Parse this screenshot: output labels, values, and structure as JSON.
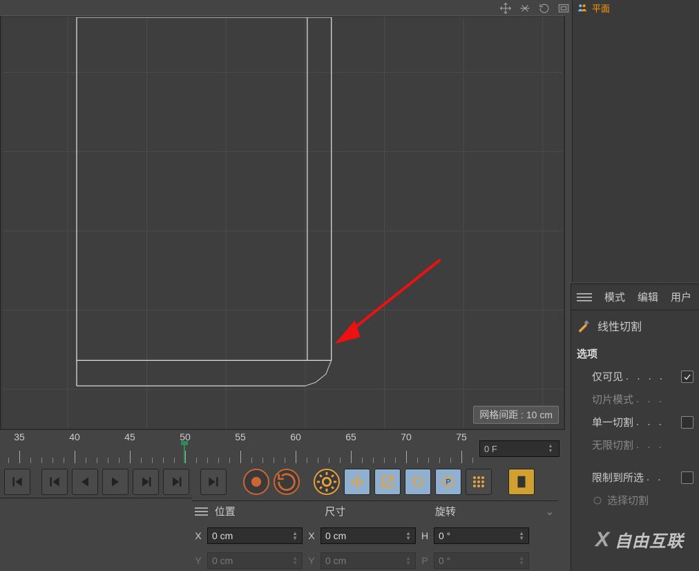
{
  "viewport": {
    "grid_label": "网格间距 : 10 cm"
  },
  "timeline": {
    "ticks": [
      "35",
      "40",
      "45",
      "50",
      "55",
      "60",
      "65",
      "70",
      "75"
    ],
    "tick_x": [
      28,
      108,
      188,
      268,
      348,
      428,
      508,
      588,
      668
    ],
    "current_frame": "0 F"
  },
  "coords": {
    "headers": {
      "pos": "位置",
      "size": "尺寸",
      "rot": "旋转"
    },
    "row1": {
      "ax1": "X",
      "v1": "0 cm",
      "ax2": "X",
      "v2": "0 cm",
      "ax3": "H",
      "v3": "0 °"
    },
    "row2": {
      "ax1": "Y",
      "v1": "0 cm",
      "ax2": "Y",
      "v2": "0 cm",
      "ax3": "P",
      "v3": "0 °"
    }
  },
  "side_top": {
    "obj_label": "平面"
  },
  "side_bot": {
    "tabs": {
      "mode": "模式",
      "edit": "编辑",
      "user": "用户"
    },
    "tool_name": "线性切割",
    "section": "选项",
    "opts": {
      "visible_only": {
        "label": "仅可见",
        "dots": ". . . .",
        "checked": true,
        "enabled": true
      },
      "slice_mode": {
        "label": "切片模式",
        "dots": ". . .",
        "checked": false,
        "enabled": false
      },
      "single_cut": {
        "label": "单一切割",
        "dots": ". . .",
        "checked": false,
        "enabled": true
      },
      "infinite_cut": {
        "label": "无限切割",
        "dots": ". . .",
        "checked": false,
        "enabled": false
      },
      "limit_sel": {
        "label": "限制到所选",
        "dots": ". .",
        "checked": false,
        "enabled": true
      },
      "select_cut": {
        "label": "选择切割",
        "dots": "",
        "checked": false,
        "enabled": true
      }
    }
  },
  "watermark": "自由互联"
}
